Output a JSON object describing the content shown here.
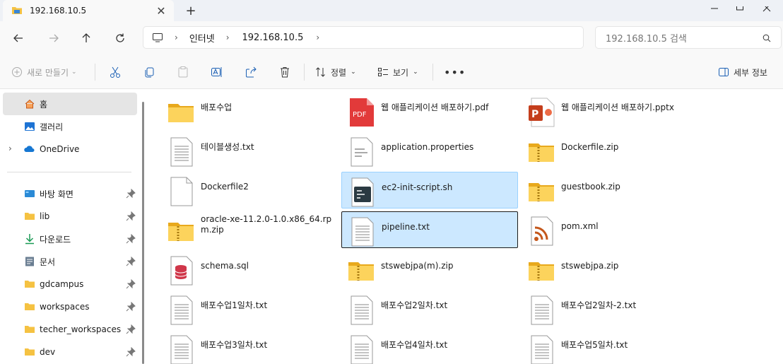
{
  "window": {
    "tab_title": "192.168.10.5"
  },
  "nav": {
    "address_segments": [
      "인터넷",
      "192.168.10.5"
    ],
    "search_placeholder": "192.168.10.5 검색"
  },
  "toolbar": {
    "new_label": "새로 만들기",
    "sort_label": "정렬",
    "view_label": "보기",
    "details_label": "세부 정보"
  },
  "sidebar": {
    "items": [
      {
        "label": "홈",
        "icon": "home-icon"
      },
      {
        "label": "갤러리",
        "icon": "gallery-icon"
      },
      {
        "label": "OneDrive",
        "icon": "onedrive-icon"
      },
      {
        "label": "바탕 화면",
        "icon": "desktop-icon"
      },
      {
        "label": "lib",
        "icon": "folder-icon"
      },
      {
        "label": "다운로드",
        "icon": "download-icon"
      },
      {
        "label": "문서",
        "icon": "documents-icon"
      },
      {
        "label": "gdcampus",
        "icon": "folder-icon"
      },
      {
        "label": "workspaces",
        "icon": "folder-icon"
      },
      {
        "label": "techer_workspaces",
        "icon": "folder-icon"
      },
      {
        "label": "dev",
        "icon": "folder-icon"
      }
    ]
  },
  "files": [
    {
      "name": "배포수업",
      "type": "folder"
    },
    {
      "name": "웹 애플리케이션 배포하기.pdf",
      "type": "pdf"
    },
    {
      "name": "웹 애플리케이션 배포하기.pptx",
      "type": "pptx"
    },
    {
      "name": "테이블생성.txt",
      "type": "txt"
    },
    {
      "name": "application.properties",
      "type": "props"
    },
    {
      "name": "Dockerfile.zip",
      "type": "zip"
    },
    {
      "name": "Dockerfile2",
      "type": "blank"
    },
    {
      "name": "ec2-init-script.sh",
      "type": "sh"
    },
    {
      "name": "guestbook.zip",
      "type": "zip"
    },
    {
      "name": "oracle-xe-11.2.0-1.0.x86_64.rpm.zip",
      "type": "zip"
    },
    {
      "name": "pipeline.txt",
      "type": "txt"
    },
    {
      "name": "pom.xml",
      "type": "xml"
    },
    {
      "name": "schema.sql",
      "type": "sql"
    },
    {
      "name": "stswebjpa(m).zip",
      "type": "zip"
    },
    {
      "name": "stswebjpa.zip",
      "type": "zip"
    },
    {
      "name": "배포수업1일차.txt",
      "type": "txt"
    },
    {
      "name": "배포수업2일차.txt",
      "type": "txt"
    },
    {
      "name": "배포수업2일차-2.txt",
      "type": "txt"
    },
    {
      "name": "배포수업3일차.txt",
      "type": "txt"
    },
    {
      "name": "배포수업4일차.txt",
      "type": "txt"
    },
    {
      "name": "배포수업5일차.txt",
      "type": "txt"
    }
  ]
}
